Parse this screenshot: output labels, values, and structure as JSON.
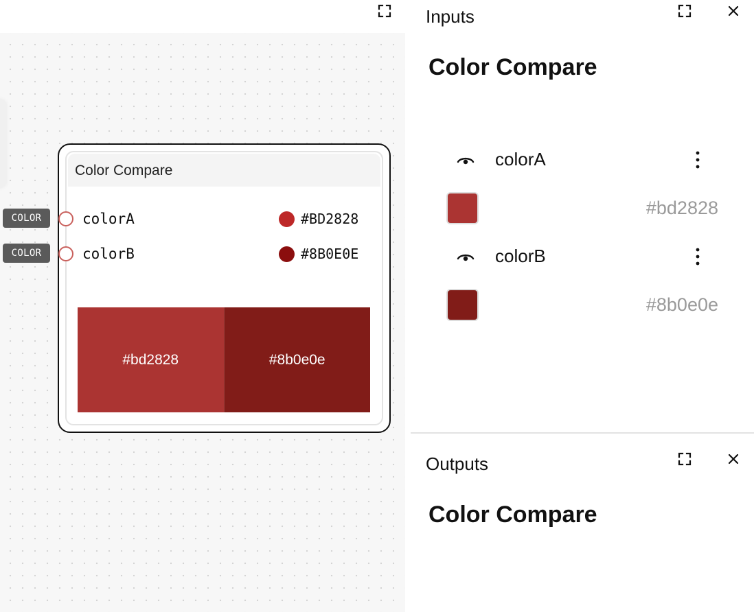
{
  "node": {
    "title": "Color Compare",
    "inputs": [
      {
        "tag": "COLOR",
        "label": "colorA",
        "value": "#BD2828",
        "color": "#bd2828"
      },
      {
        "tag": "COLOR",
        "label": "colorB",
        "value": "#8B0E0E",
        "color": "#8b0e0e"
      }
    ],
    "compare": [
      {
        "label": "#bd2828",
        "color": "#ab3432"
      },
      {
        "label": "#8b0e0e",
        "color": "#811c18"
      }
    ]
  },
  "inputs_panel": {
    "title": "Inputs",
    "heading": "Color Compare",
    "items": [
      {
        "name": "colorA",
        "value": "#bd2828",
        "color": "#ab3432"
      },
      {
        "name": "colorB",
        "value": "#8b0e0e",
        "color": "#811c18"
      }
    ]
  },
  "outputs_panel": {
    "title": "Outputs",
    "heading": "Color Compare"
  },
  "icons": {
    "expand": "expand-icon",
    "close": "close-icon",
    "visibility": "eye-icon",
    "menu": "kebab-menu-icon"
  }
}
